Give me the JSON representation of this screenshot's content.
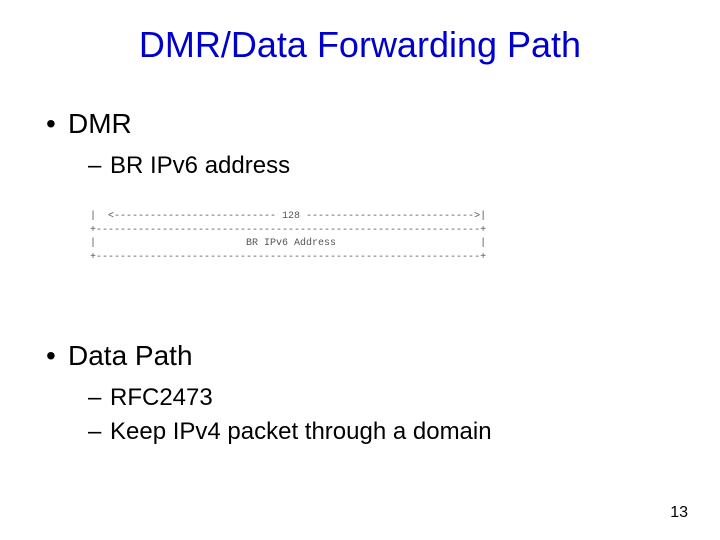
{
  "title": "DMR/Data Forwarding Path",
  "section1": {
    "heading": "DMR",
    "sub1": "BR IPv6 address"
  },
  "diagram": {
    "line1": "|  <--------------------------- 128 ---------------------------->|",
    "line2": "+----------------------------------------------------------------+",
    "line3": "|                         BR IPv6 Address                        |",
    "line4": "+----------------------------------------------------------------+"
  },
  "section2": {
    "heading": "Data Path",
    "sub1": "RFC2473",
    "sub2": "Keep IPv4 packet through a domain"
  },
  "page_number": "13"
}
